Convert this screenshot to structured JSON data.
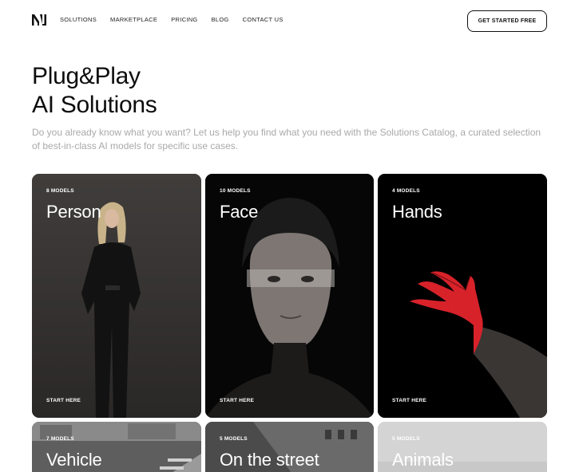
{
  "nav": {
    "links": [
      "SOLUTIONS",
      "MARKETPLACE",
      "PRICING",
      "BLOG",
      "CONTACT US"
    ],
    "cta_label": "GET STARTED FREE"
  },
  "hero": {
    "title_line1": "Plug&Play",
    "title_line2": "AI Solutions",
    "subtitle": "Do you already know what you want? Let us help you find what you need with the Solutions Catalog, a curated selection of best-in-class AI models for specific use cases."
  },
  "cards": [
    {
      "count": "8 MODELS",
      "name": "Person",
      "start": "START HERE"
    },
    {
      "count": "10 MODELS",
      "name": "Face",
      "start": "START HERE"
    },
    {
      "count": "4 MODELS",
      "name": "Hands",
      "start": "START HERE"
    },
    {
      "count": "7 MODELS",
      "name": "Vehicle"
    },
    {
      "count": "5 MODELS",
      "name": "On the street"
    },
    {
      "count": "5 MODELS",
      "name": "Animals"
    }
  ],
  "colors": {
    "accent_hand": "#d8222a",
    "subtitle_gray": "#a9a9a9"
  }
}
